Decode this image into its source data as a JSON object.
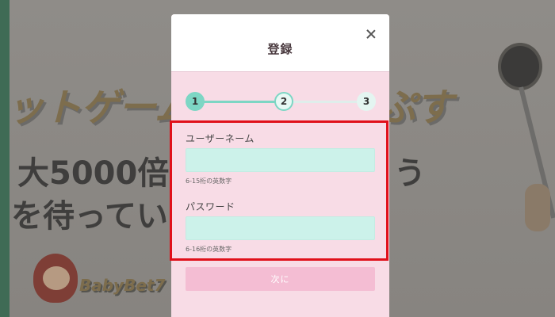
{
  "background": {
    "headline": "ットゲーム　　　　　ぷす",
    "line2_left": "大5000倍ま",
    "line2_right": "う",
    "line3": "を待っていま",
    "logo_text": "BabyBet7"
  },
  "modal": {
    "title": "登録",
    "close_icon": "close-icon",
    "steps": [
      "1",
      "2",
      "3"
    ],
    "current_step": 2,
    "username": {
      "label": "ユーザーネーム",
      "value": "",
      "placeholder": "",
      "hint": "6-15桁の英数字"
    },
    "password": {
      "label": "パスワード",
      "value": "",
      "placeholder": "",
      "hint": "6-16桁の英数字"
    },
    "next_label": "次に"
  },
  "colors": {
    "accent": "#7dd6c4",
    "modal_bg": "#f8dce6",
    "input_bg": "#ccf2ea",
    "button_bg": "#f4bdd3",
    "highlight": "#e0101a"
  }
}
